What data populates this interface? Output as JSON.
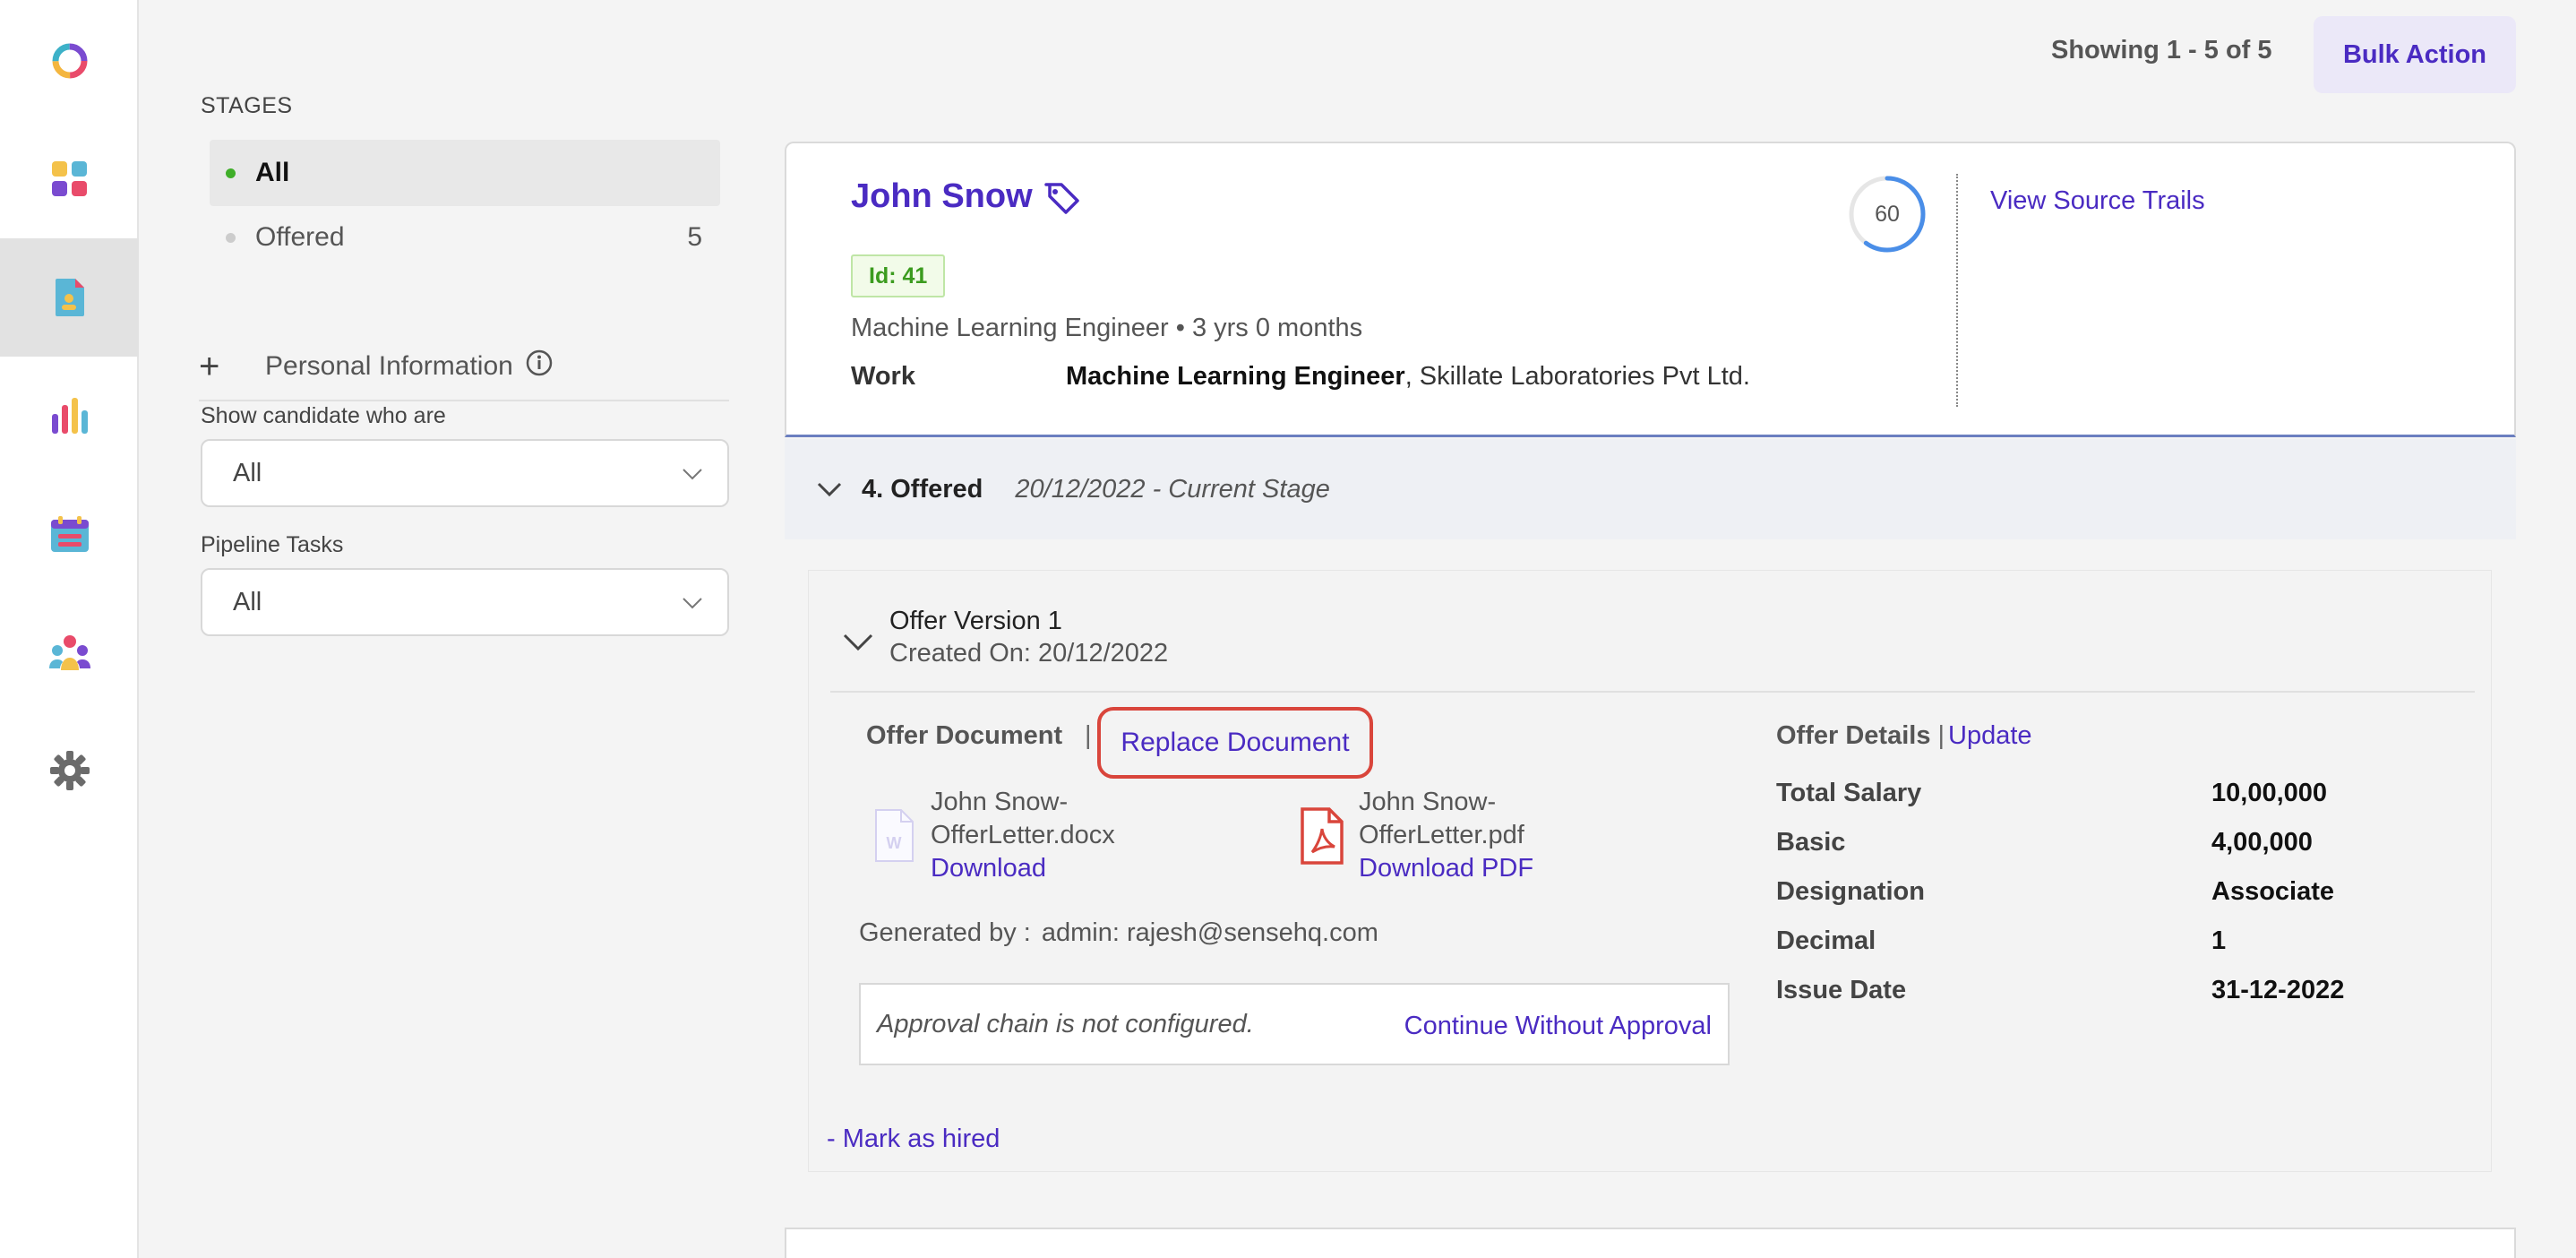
{
  "rail": {
    "items": [
      {
        "icon": "app-logo-icon"
      },
      {
        "icon": "dashboard-icon"
      },
      {
        "icon": "candidates-icon",
        "active": true
      },
      {
        "icon": "analytics-icon"
      },
      {
        "icon": "calendar-icon"
      },
      {
        "icon": "team-icon"
      },
      {
        "icon": "settings-icon"
      }
    ]
  },
  "sidebar": {
    "stages_title": "STAGES",
    "stages": [
      {
        "label": "All",
        "count": "",
        "active": true,
        "dot_color": "#3fae29"
      },
      {
        "label": "Offered",
        "count": "5",
        "active": false,
        "dot_color": "#cccccc"
      }
    ],
    "personal_info": "Personal Information",
    "show_candidate_label": "Show candidate who are",
    "show_candidate_value": "All",
    "pipeline_tasks_label": "Pipeline Tasks",
    "pipeline_tasks_value": "All"
  },
  "header": {
    "showing": "Showing 1 - 5 of 5",
    "bulk_action": "Bulk Action"
  },
  "candidate": {
    "name": "John Snow",
    "id_badge": "Id: 41",
    "role_line": "Machine Learning Engineer • 3 yrs 0 months",
    "work_label": "Work",
    "work_title": "Machine Learning Engineer",
    "work_company": ", Skillate Laboratories Pvt Ltd.",
    "score": "60",
    "score_fraction": 0.6,
    "view_source_trails": "View Source Trails"
  },
  "stage": {
    "name": "4. Offered",
    "date": "20/12/2022 - Current Stage"
  },
  "offer": {
    "version": "Offer Version 1",
    "created": "Created On: 20/12/2022",
    "document_label": "Offer Document",
    "separator": "|",
    "replace_document": "Replace Document",
    "files": [
      {
        "name_line1": "John Snow-",
        "name_line2": "OfferLetter.docx",
        "link": "Download",
        "icon": "word-file-icon"
      },
      {
        "name_line1": "John Snow-",
        "name_line2": "OfferLetter.pdf",
        "link": "Download PDF",
        "icon": "pdf-file-icon"
      }
    ],
    "generated_label": "Generated by :",
    "generated_value": "admin: rajesh@sensehq.com",
    "approval_text": "Approval chain is not configured.",
    "approval_link": "Continue Without Approval",
    "mark_hired": "- Mark as hired",
    "details_label": "Offer Details",
    "details_update": "Update",
    "details": [
      {
        "label": "Total Salary",
        "value": "10,00,000"
      },
      {
        "label": "Basic",
        "value": "4,00,000"
      },
      {
        "label": "Designation",
        "value": "Associate"
      },
      {
        "label": "Decimal",
        "value": "1"
      },
      {
        "label": "Issue Date",
        "value": "31-12-2022"
      }
    ]
  },
  "colors": {
    "accent": "#4a2bc2",
    "highlight_ring": "#d9453b",
    "score_ring": "#4a8ee8"
  }
}
